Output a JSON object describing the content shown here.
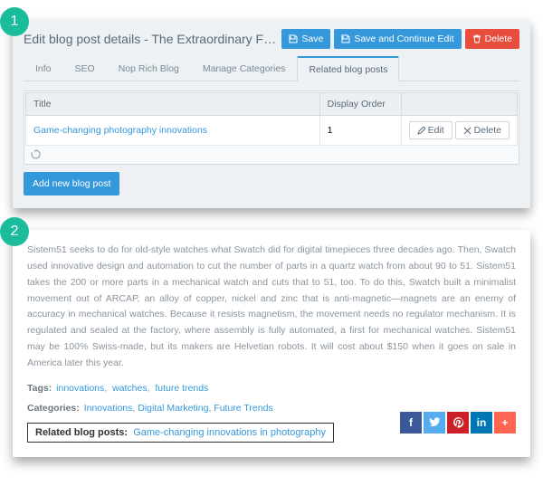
{
  "panel1": {
    "title": "Edit blog post details - The Extraordinary Future of Shoes",
    "buttons": {
      "save": "Save",
      "save_continue": "Save and Continue Edit",
      "delete": "Delete"
    },
    "tabs": [
      "Info",
      "SEO",
      "Nop Rich Blog",
      "Manage Categories",
      "Related blog posts"
    ],
    "active_tab": 4,
    "table": {
      "headers": [
        "Title",
        "Display Order",
        ""
      ],
      "rows": [
        {
          "title": "Game-changing photography innovations",
          "order": "1"
        }
      ],
      "edit": "Edit",
      "del": "Delete"
    },
    "add_button": "Add new blog post"
  },
  "panel2": {
    "body": "Sistem51 seeks to do for old-style watches what Swatch did for digital timepieces three decades ago. Then, Swatch used innovative design and automation to cut the number of parts in a quartz watch from about 90 to 51. Sistem51 takes the 200 or more parts in a mechanical watch and cuts that to 51, too. To do this, Swatch built a minimalist movement out of ARCAP, an alloy of copper, nickel and zinc that is anti-magnetic—magnets are an enemy of accuracy in mechanical watches. Because it resists magnetism, the movement needs no regulator mechanism. It is regulated and sealed at the factory, where assembly is fully automated, a first for mechanical watches. Sistem51 may be 100% Swiss-made, but its makers are Helvetian robots. It will cost about $150 when it goes on sale in America later this year.",
    "tags_label": "Tags:",
    "tags": [
      "innovations",
      "watches",
      "future trends"
    ],
    "cats_label": "Categories:",
    "cats": [
      "Innovations",
      "Digital Marketing",
      "Future Trends"
    ],
    "related_label": "Related blog posts:",
    "related_link": "Game-changing innovations in photography"
  },
  "badges": {
    "one": "1",
    "two": "2"
  }
}
